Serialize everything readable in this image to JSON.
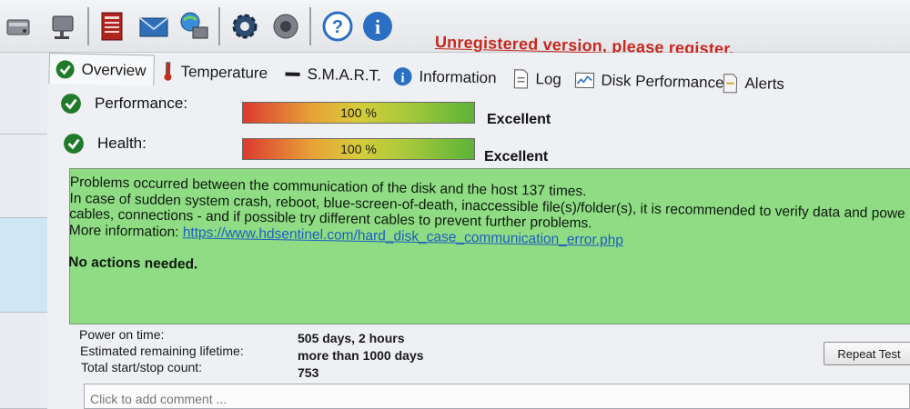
{
  "toolbar": {
    "buttons": [
      {
        "name": "disk-icon"
      },
      {
        "name": "disk-network-icon"
      },
      {
        "name": "report-icon"
      },
      {
        "name": "mail-icon"
      },
      {
        "name": "network-computer-icon"
      },
      {
        "name": "gear-icon"
      },
      {
        "name": "speaker-icon"
      },
      {
        "name": "help-icon"
      },
      {
        "name": "info-icon"
      }
    ],
    "unregistered_text": "Unregistered version, please register."
  },
  "tabs": [
    {
      "label": "Overview",
      "icon": "check-icon",
      "active": true
    },
    {
      "label": "Temperature",
      "icon": "thermometer-icon"
    },
    {
      "label": "S.M.A.R.T.",
      "icon": "dash-icon"
    },
    {
      "label": "Information",
      "icon": "info-icon"
    },
    {
      "label": "Log",
      "icon": "document-icon"
    },
    {
      "label": "Disk Performance",
      "icon": "graph-icon"
    },
    {
      "label": "Alerts",
      "icon": "alerts-icon"
    }
  ],
  "performance": {
    "label": "Performance:",
    "percent_text": "100 %",
    "value": 1.0,
    "rating": "Excellent"
  },
  "health": {
    "label": "Health:",
    "percent_text": "100 %",
    "value": 1.0,
    "rating": "Excellent"
  },
  "message": {
    "lines": [
      "Problems occurred between the communication of the disk and the host 137 times.",
      "In case of sudden system crash, reboot, blue-screen-of-death, inaccessible file(s)/folder(s), it is recommended to verify data and powe",
      "cables, connections - and if possible try different cables to prevent further problems."
    ],
    "more_info_label": "More information:",
    "more_info_link": "https://www.hdsentinel.com/hard_disk_case_communication_error.php",
    "actions": "No actions needed."
  },
  "stats": [
    {
      "label": "Power on time:",
      "value": "505 days, 2 hours"
    },
    {
      "label": "Estimated remaining lifetime:",
      "value": "more than 1000 days"
    },
    {
      "label": "Total start/stop count:",
      "value": "753"
    }
  ],
  "repeat_test_label": "Repeat Test",
  "comment_placeholder": "Click to add comment ...",
  "colors": {
    "accent_red": "#c8281e",
    "message_bg": "#8fdc84",
    "check_green": "#1f7a2a",
    "link": "#1d5fbf"
  }
}
